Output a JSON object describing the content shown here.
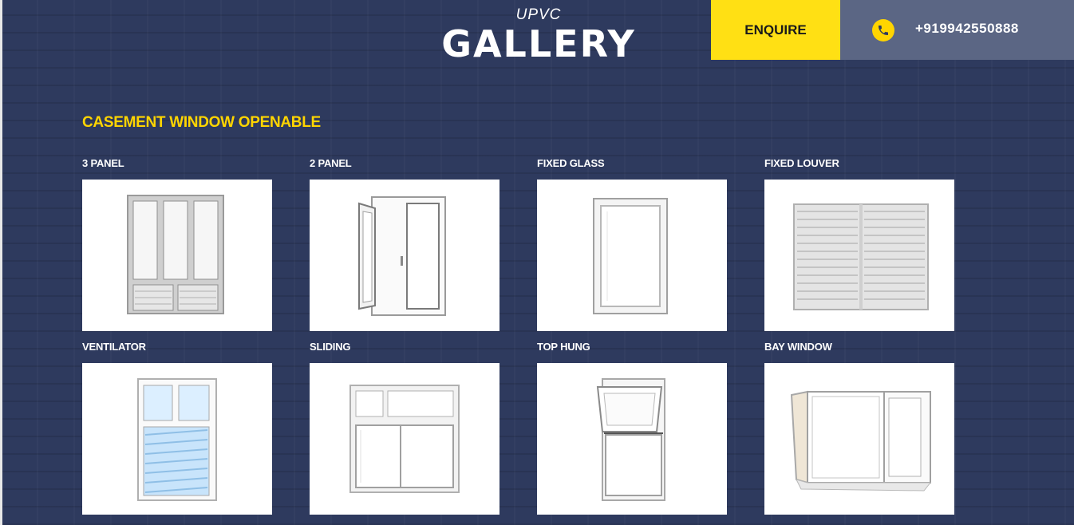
{
  "header": {
    "subtitle": "UPVC",
    "title": "GALLERY",
    "enquire_label": "ENQUIRE",
    "phone_icon": "phone-icon",
    "phone_number": "+919942550888"
  },
  "colors": {
    "background": "#2e3a5e",
    "accent_yellow": "#ffe014",
    "phone_box": "#5b6684"
  },
  "section": {
    "title": "CASEMENT WINDOW OPENABLE"
  },
  "gallery": [
    {
      "label": "3 PANEL"
    },
    {
      "label": "2 PANEL"
    },
    {
      "label": "FIXED GLASS"
    },
    {
      "label": "FIXED LOUVER"
    },
    {
      "label": "VENTILATOR"
    },
    {
      "label": "SLIDING"
    },
    {
      "label": "TOP HUNG"
    },
    {
      "label": "BAY WINDOW"
    }
  ]
}
